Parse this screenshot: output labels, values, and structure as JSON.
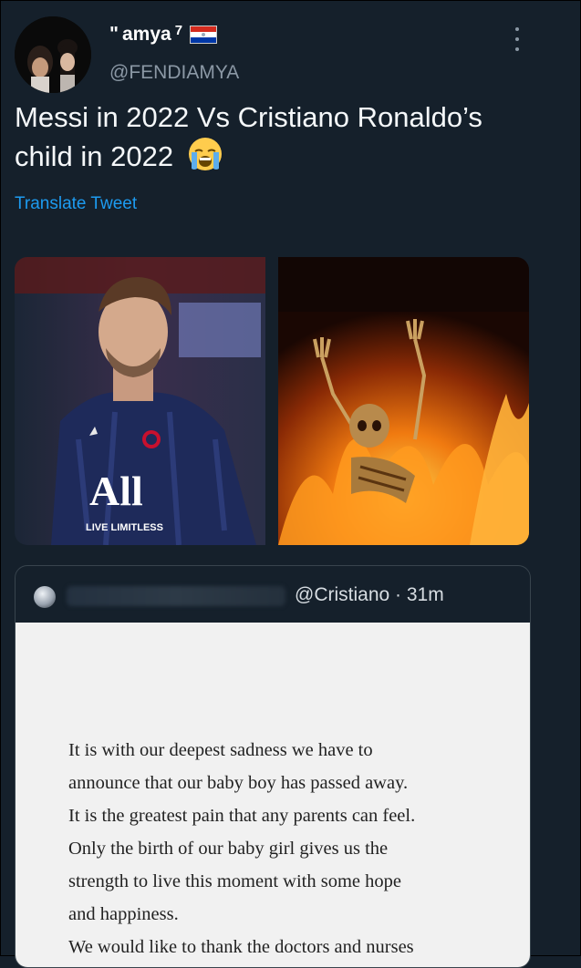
{
  "author": {
    "name": "amya",
    "name_prefix": "ʺ",
    "name_superscript": "7",
    "flag_icon": "paraguay-flag-icon",
    "handle": "@FENDIAMYA"
  },
  "tweet": {
    "text": "Messi in 2022 Vs Cristiano Ronaldo’s child in 2022",
    "emoji_icon": "loudly-crying-face-icon",
    "translate_label": "Translate Tweet"
  },
  "media": {
    "left_image": "messi-photo",
    "left_caption": "LIVE LIMITLESS",
    "left_logo": "All",
    "right_image": "burning-skeleton-photo"
  },
  "quote": {
    "handle_time": "@Cristiano · 31m",
    "letter_lines": [
      "It is with our deepest sadness we have to",
      "announce that our baby boy has passed away.",
      "It is the greatest pain that any parents can feel.",
      "Only the birth of our baby girl gives us the",
      "strength to live this moment with some hope",
      "and happiness.",
      "We would like to thank the doctors and nurses"
    ]
  },
  "colors": {
    "background": "#15202b",
    "link": "#1d9bf0",
    "secondary_text": "#8b98a5"
  }
}
